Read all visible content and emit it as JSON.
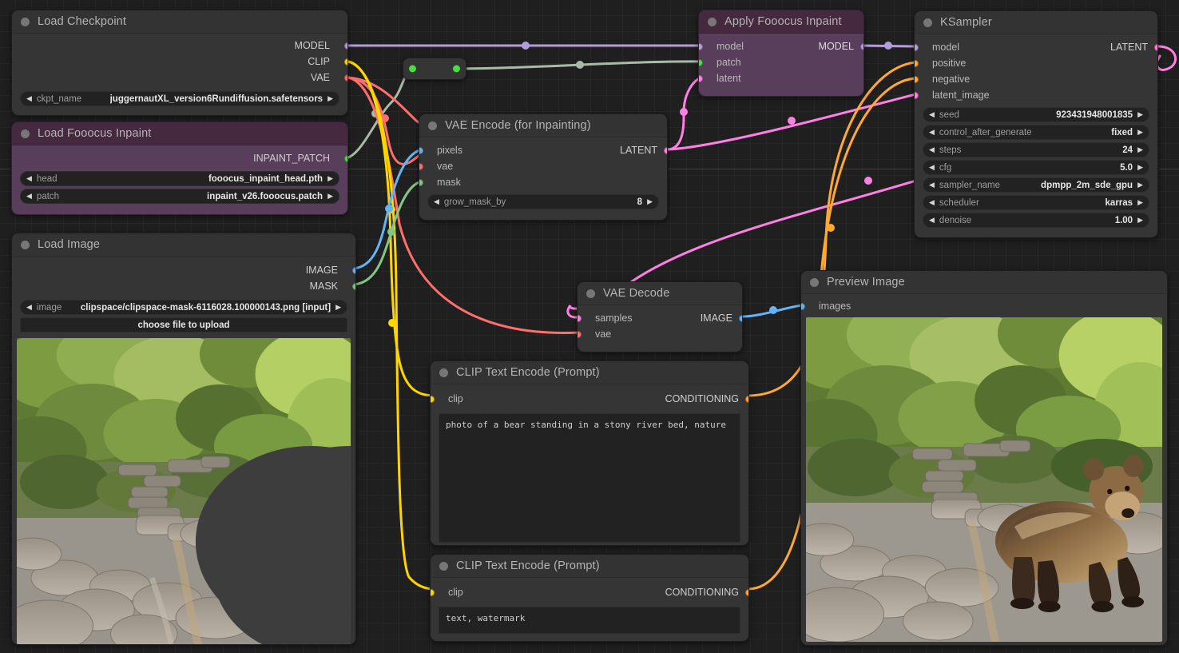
{
  "app": {
    "name": "ComfyUI",
    "canvas_background": "#1f1f1f",
    "grid_color": "#2a2a2a"
  },
  "colors": {
    "MODEL": "#b39ddb",
    "CLIP": "#ffd500",
    "VAE": "#ff6e6e",
    "LATENT": "#ff80e4",
    "IMAGE": "#64b5f6",
    "MASK": "#81c784",
    "CONDITIONING": "#ffa931",
    "INPAINT_PATCH": "#46e03e",
    "node_body": "#353535",
    "node_header": "#333333",
    "node_purple_body": "#583e5a",
    "node_purple_header": "#44293f"
  },
  "nodes": {
    "load_checkpoint": {
      "title": "Load Checkpoint",
      "outputs": [
        {
          "label": "MODEL",
          "type": "MODEL"
        },
        {
          "label": "CLIP",
          "type": "CLIP"
        },
        {
          "label": "VAE",
          "type": "VAE"
        }
      ],
      "widgets": [
        {
          "name": "ckpt_name",
          "value": "juggernautXL_version6Rundiffusion.safetensors"
        }
      ]
    },
    "load_fooocus_inpaint": {
      "title": "Load Fooocus Inpaint",
      "outputs": [
        {
          "label": "INPAINT_PATCH",
          "type": "INPAINT_PATCH"
        }
      ],
      "widgets": [
        {
          "name": "head",
          "value": "fooocus_inpaint_head.pth"
        },
        {
          "name": "patch",
          "value": "inpaint_v26.fooocus.patch"
        }
      ]
    },
    "load_image": {
      "title": "Load Image",
      "outputs": [
        {
          "label": "IMAGE",
          "type": "IMAGE"
        },
        {
          "label": "MASK",
          "type": "MASK"
        }
      ],
      "widgets": [
        {
          "name": "image",
          "value": "clipspace/clipspace-mask-6116028.100000143.png [input]"
        }
      ],
      "upload_button": "choose file to upload",
      "image_caption": "forest stream with stone riverbed, masked region shown as dark ellipse"
    },
    "vae_encode_inpaint": {
      "title": "VAE Encode (for Inpainting)",
      "inputs": [
        {
          "label": "pixels",
          "type": "IMAGE"
        },
        {
          "label": "vae",
          "type": "VAE"
        },
        {
          "label": "mask",
          "type": "MASK"
        }
      ],
      "outputs": [
        {
          "label": "LATENT",
          "type": "LATENT"
        }
      ],
      "widgets": [
        {
          "name": "grow_mask_by",
          "value": "8"
        }
      ]
    },
    "apply_fooocus_inpaint": {
      "title": "Apply Fooocus Inpaint",
      "inputs": [
        {
          "label": "model",
          "type": "MODEL"
        },
        {
          "label": "patch",
          "type": "INPAINT_PATCH"
        },
        {
          "label": "latent",
          "type": "LATENT"
        }
      ],
      "outputs": [
        {
          "label": "MODEL",
          "type": "MODEL"
        }
      ]
    },
    "ksampler": {
      "title": "KSampler",
      "inputs": [
        {
          "label": "model",
          "type": "MODEL"
        },
        {
          "label": "positive",
          "type": "CONDITIONING"
        },
        {
          "label": "negative",
          "type": "CONDITIONING"
        },
        {
          "label": "latent_image",
          "type": "LATENT"
        }
      ],
      "outputs": [
        {
          "label": "LATENT",
          "type": "LATENT"
        }
      ],
      "widgets": [
        {
          "name": "seed",
          "value": "923431948001835"
        },
        {
          "name": "control_after_generate",
          "value": "fixed"
        },
        {
          "name": "steps",
          "value": "24"
        },
        {
          "name": "cfg",
          "value": "5.0"
        },
        {
          "name": "sampler_name",
          "value": "dpmpp_2m_sde_gpu"
        },
        {
          "name": "scheduler",
          "value": "karras"
        },
        {
          "name": "denoise",
          "value": "1.00"
        }
      ]
    },
    "vae_decode": {
      "title": "VAE Decode",
      "inputs": [
        {
          "label": "samples",
          "type": "LATENT"
        },
        {
          "label": "vae",
          "type": "VAE"
        }
      ],
      "outputs": [
        {
          "label": "IMAGE",
          "type": "IMAGE"
        }
      ]
    },
    "clip_positive": {
      "title": "CLIP Text Encode (Prompt)",
      "inputs": [
        {
          "label": "clip",
          "type": "CLIP"
        }
      ],
      "outputs": [
        {
          "label": "CONDITIONING",
          "type": "CONDITIONING"
        }
      ],
      "text": "photo of a bear standing in a stony river bed, nature"
    },
    "clip_negative": {
      "title": "CLIP Text Encode (Prompt)",
      "inputs": [
        {
          "label": "clip",
          "type": "CLIP"
        }
      ],
      "outputs": [
        {
          "label": "CONDITIONING",
          "type": "CONDITIONING"
        }
      ],
      "text": "text, watermark"
    },
    "preview_image": {
      "title": "Preview Image",
      "inputs": [
        {
          "label": "images",
          "type": "IMAGE"
        }
      ],
      "image_caption": "brown bear standing in a stony river bed in a green forest"
    },
    "reroute": {
      "title": "",
      "type": "INPAINT_PATCH"
    }
  }
}
